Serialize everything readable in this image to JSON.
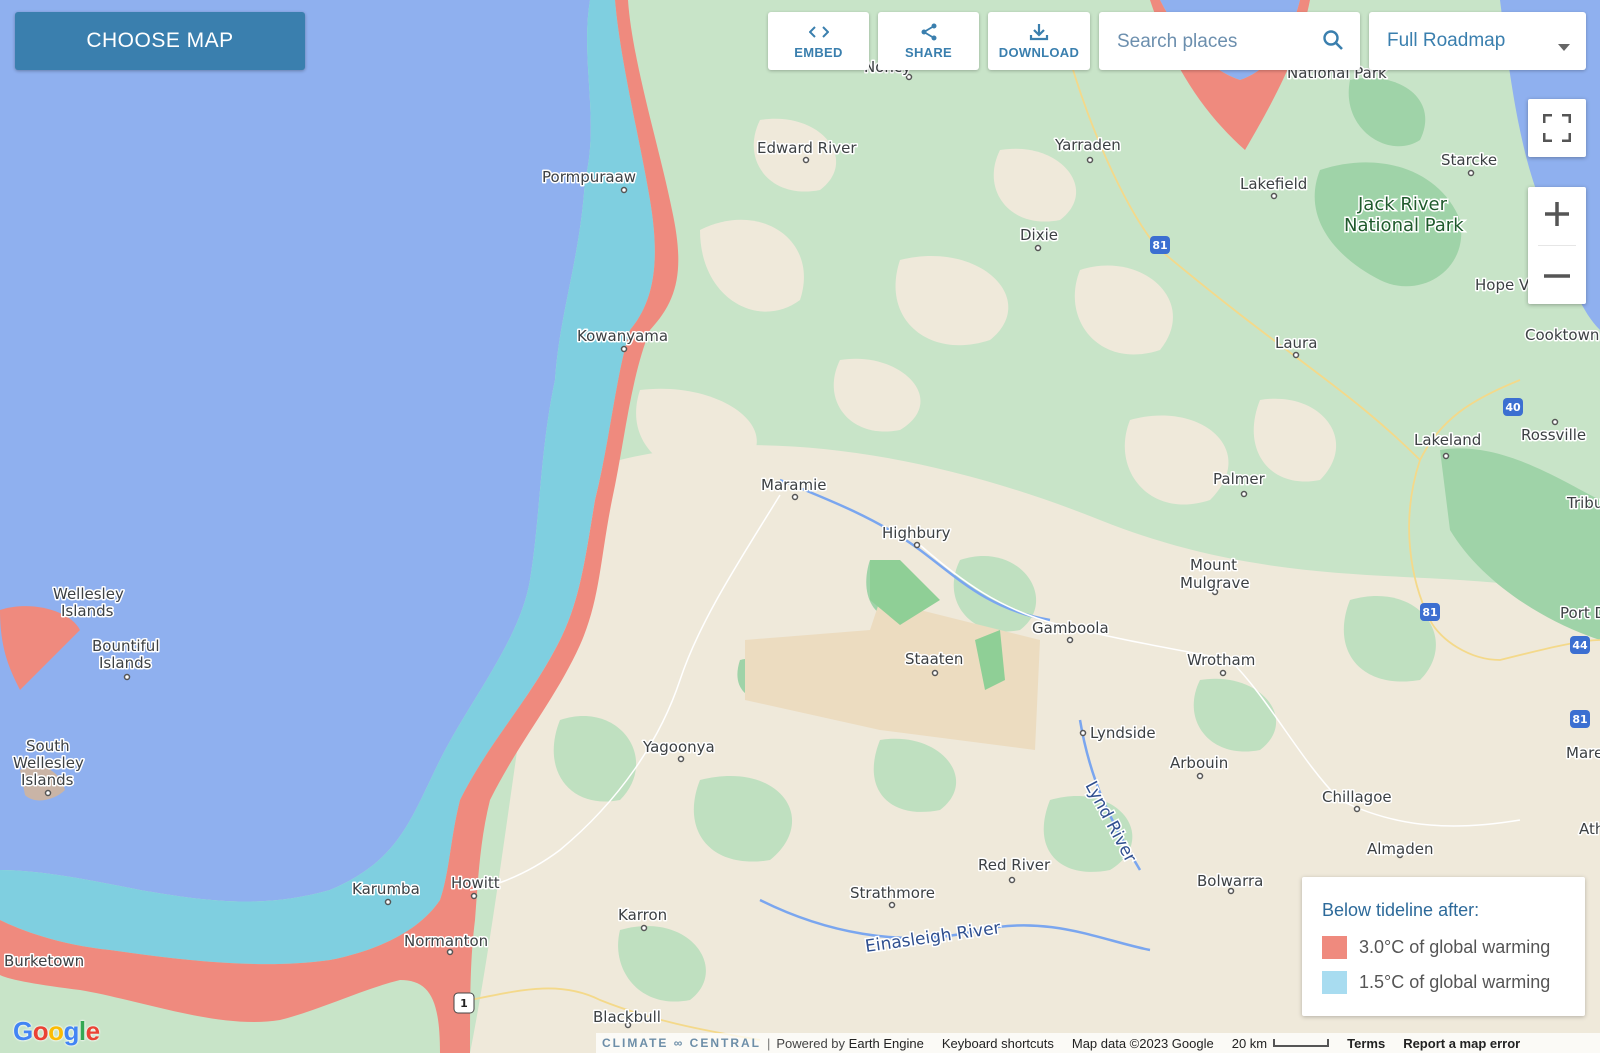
{
  "controls": {
    "choose_map": "CHOOSE MAP",
    "embed": "EMBED",
    "share": "SHARE",
    "download": "DOWNLOAD",
    "search_placeholder": "Search places",
    "map_type": "Full Roadmap"
  },
  "legend": {
    "title": "Below tideline after:",
    "items": [
      {
        "label": "3.0°C of global warming",
        "color": "#ef8a7e"
      },
      {
        "label": "1.5°C of global warming",
        "color": "#a8dcf0"
      }
    ]
  },
  "places": [
    "Edward River",
    "Pormpuraaw",
    "Kowanyama",
    "Yarraden",
    "Dixie",
    "Lakefield",
    "Starcke",
    "Laura",
    "Cooktown",
    "Hope V",
    "Lakeland",
    "Rossville",
    "Palmer",
    "Maramie",
    "Highbury",
    "Mount",
    "Mulgrave",
    "Gamboola",
    "Wrotham",
    "Staaten",
    "Port D",
    "Tribu",
    "Lyndside",
    "Arbouin",
    "Chillagoe",
    "Yagoonya",
    "Mare",
    "Ath",
    "Almaden",
    "Red River",
    "Bolwarra",
    "Strathmore",
    "Karron",
    "Howitt",
    "Karumba",
    "Normanton",
    "Burketown",
    "Blackbull",
    "Wellesley",
    "Islands",
    "Bountiful",
    "Islands",
    "South",
    "Wellesley",
    "Islands",
    "Noncy",
    "National Park"
  ],
  "parks": [
    "Jack River",
    "National Park"
  ],
  "rivers": [
    "Lynd River",
    "Einasleigh River"
  ],
  "road_shields": [
    "81",
    "40",
    "81",
    "44",
    "81",
    "1"
  ],
  "attribution": {
    "climate_central": "CLIMATE",
    "climate_central_2": "CENTRAL",
    "powered_by": "Powered by",
    "earth_engine": "Earth Engine",
    "keyboard": "Keyboard shortcuts",
    "map_data": "Map data ©2023 Google",
    "scale": "20 km",
    "terms": "Terms",
    "report": "Report a map error"
  },
  "google_logo": "Google",
  "colors": {
    "ocean": "#8fb0ef",
    "land_green": "#c8e4c8",
    "land_tan": "#efe9da",
    "rise_3": "#ef8a7e",
    "rise_15": "#7fcfe0",
    "accent": "#3a7fae"
  }
}
